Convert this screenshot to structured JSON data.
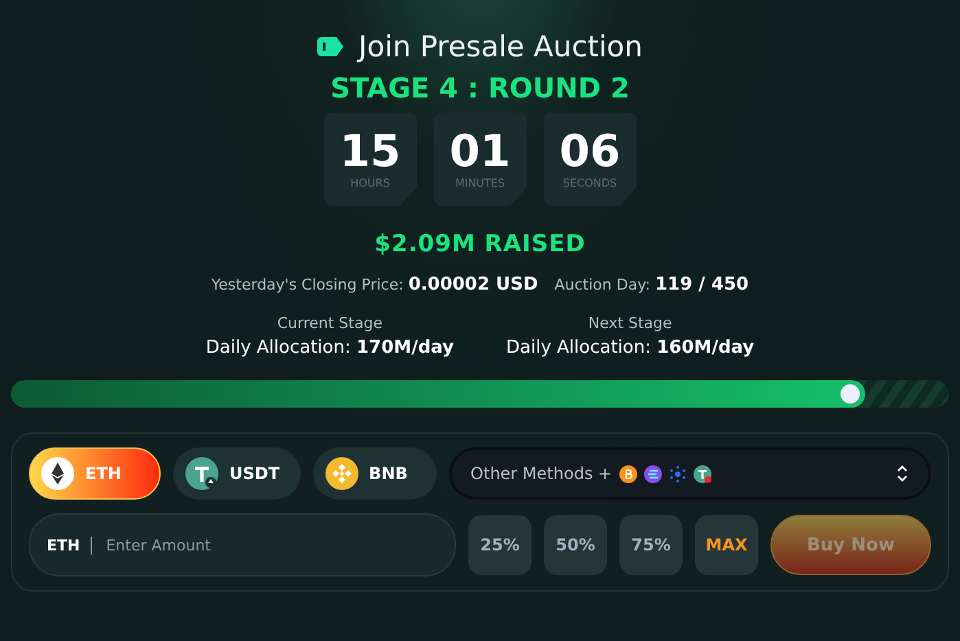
{
  "title": "Join Presale Auction",
  "stage": "STAGE 4 : ROUND 2",
  "countdown": [
    {
      "value": "15",
      "unit": "HOURS"
    },
    {
      "value": "01",
      "unit": "MINUTES"
    },
    {
      "value": "06",
      "unit": "SECONDS"
    }
  ],
  "raised": "$2.09M RAISED",
  "info": [
    {
      "label": "Yesterday's Closing Price:",
      "value": "0.00002 USD"
    },
    {
      "label": "Auction Day:",
      "value": "119 / 450"
    }
  ],
  "stages": [
    {
      "heading": "Current Stage",
      "label": "Daily Allocation:",
      "value": "170M/day"
    },
    {
      "heading": "Next Stage",
      "label": "Daily Allocation:",
      "value": "160M/day"
    }
  ],
  "progress": {
    "level": 0.91
  },
  "currencies": [
    {
      "kind": "eth",
      "label": "ETH",
      "selected": true
    },
    {
      "kind": "usdt",
      "label": "USDT",
      "selected": false
    },
    {
      "kind": "bnb",
      "label": "BNB",
      "selected": false
    }
  ],
  "other_methods": {
    "label": "Other Methods +"
  },
  "amount": {
    "currency": "ETH",
    "placeholder": "Enter Amount"
  },
  "quick_amounts": [
    {
      "kind": "percent",
      "label": "25%"
    },
    {
      "kind": "percent",
      "label": "50%"
    },
    {
      "kind": "percent",
      "label": "75%"
    },
    {
      "kind": "max",
      "label": "MAX"
    }
  ],
  "buy_button": {
    "label": "Buy Now",
    "disabled": true
  }
}
